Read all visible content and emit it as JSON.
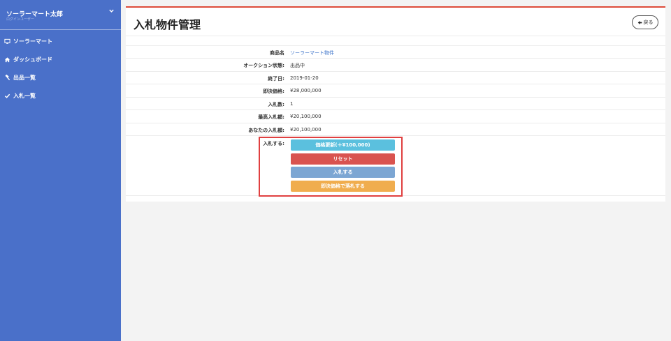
{
  "sidebar": {
    "user_name": "ソーラーマート太郎",
    "user_role": "ログインユーザー",
    "items": [
      {
        "label": "ソーラーマート",
        "icon": "monitor-icon"
      },
      {
        "label": "ダッシュボード",
        "icon": "home-icon"
      },
      {
        "label": "出品一覧",
        "icon": "gavel-icon"
      },
      {
        "label": "入札一覧",
        "icon": "check-icon"
      }
    ]
  },
  "header": {
    "title": "入札物件管理",
    "back_label": "戻る"
  },
  "details": [
    {
      "label": "商品名",
      "value": "ソーラーマート物件"
    },
    {
      "label": "オークション状態:",
      "value": "出品中"
    },
    {
      "label": "終了日:",
      "value": "2019-01-20"
    },
    {
      "label": "即決価格:",
      "value": "¥28,000,000"
    },
    {
      "label": "入札数:",
      "value": "1"
    },
    {
      "label": "最高入札額:",
      "value": "¥20,100,000"
    },
    {
      "label": "あなたの入札額:",
      "value": "¥20,100,000"
    }
  ],
  "bid": {
    "label": "入札する:",
    "buttons": [
      {
        "label": "価格更新(＋¥100,000)",
        "color": "#5bc0de"
      },
      {
        "label": "リセット",
        "color": "#d9534f"
      },
      {
        "label": "入札する",
        "color": "#7ca6d3"
      },
      {
        "label": "即決価格で落札する",
        "color": "#f0ad4e"
      }
    ]
  },
  "colors": {
    "sidebar_bg": "#4a70c9",
    "card_accent": "#dd4b39",
    "highlight": "#e04040"
  }
}
